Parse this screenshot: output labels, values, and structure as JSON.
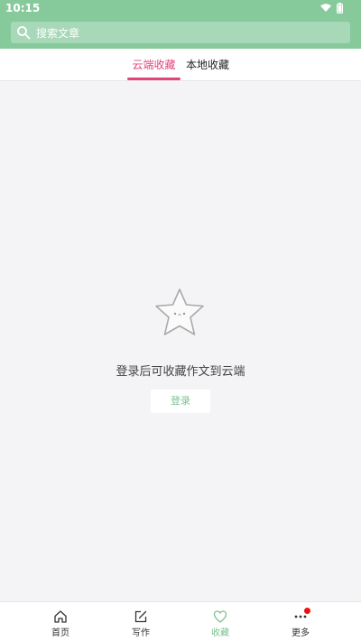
{
  "status_bar": {
    "time": "10:15",
    "icons": [
      "wifi-icon",
      "battery-icon"
    ]
  },
  "header": {
    "search": {
      "icon": "search-icon",
      "placeholder": "搜索文章"
    }
  },
  "tabs": [
    {
      "label": "云端收藏",
      "active": true
    },
    {
      "label": "本地收藏",
      "active": false
    }
  ],
  "content": {
    "empty_state": {
      "icon": "star-face-icon",
      "message": "登录后可收藏作文到云端",
      "button_label": "登录"
    }
  },
  "bottom_nav": {
    "items": [
      {
        "label": "首页",
        "icon": "home-icon",
        "active": false
      },
      {
        "label": "写作",
        "icon": "write-icon",
        "active": false
      },
      {
        "label": "收藏",
        "icon": "heart-icon",
        "active": true
      },
      {
        "label": "更多",
        "icon": "more-icon",
        "active": false,
        "badge": true
      }
    ]
  },
  "colors": {
    "header_green": "#86c99b",
    "accent_pink": "#e2447b",
    "accent_green": "#7bc08f",
    "badge_red": "#ee1111"
  }
}
